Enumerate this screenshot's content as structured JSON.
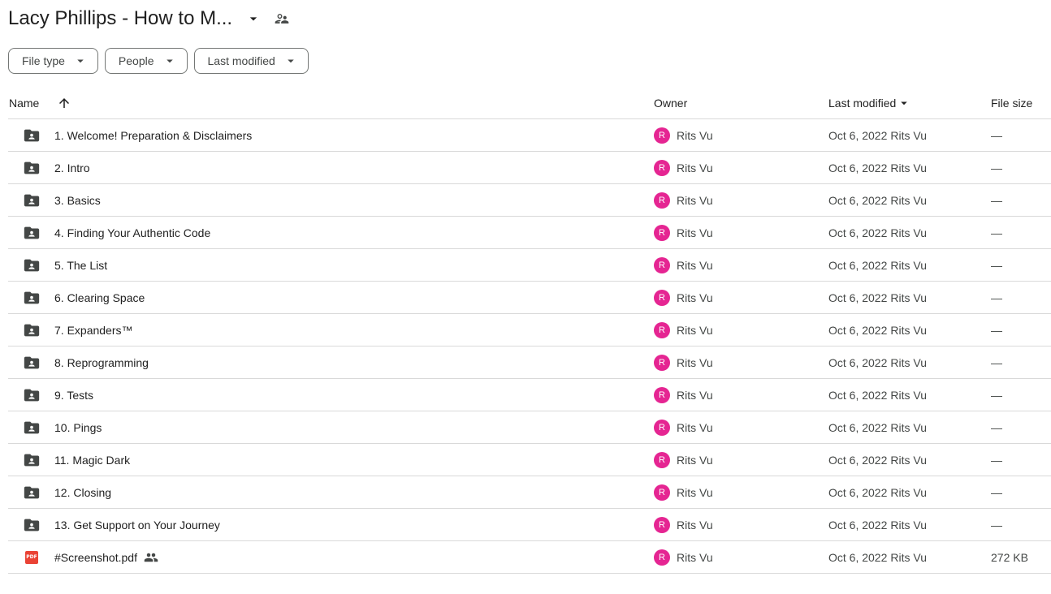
{
  "header": {
    "title": "Lacy Phillips - How to M...",
    "caret_icon": "arrow-drop-down-icon",
    "shared_icon": "shared-folder-people-icon"
  },
  "filters": [
    {
      "label": "File type"
    },
    {
      "label": "People"
    },
    {
      "label": "Last modified"
    }
  ],
  "table": {
    "columns": {
      "name": "Name",
      "owner": "Owner",
      "last_modified": "Last modified",
      "file_size": "File size"
    },
    "rows": [
      {
        "name": "1. Welcome! Preparation & Disclaimers",
        "type": "shared-folder",
        "owner": "Rits Vu",
        "owner_initial": "R",
        "date": "Oct 6, 2022",
        "modified_by": "Rits Vu",
        "size": "—"
      },
      {
        "name": "2. Intro",
        "type": "shared-folder",
        "owner": "Rits Vu",
        "owner_initial": "R",
        "date": "Oct 6, 2022",
        "modified_by": "Rits Vu",
        "size": "—"
      },
      {
        "name": "3. Basics",
        "type": "shared-folder",
        "owner": "Rits Vu",
        "owner_initial": "R",
        "date": "Oct 6, 2022",
        "modified_by": "Rits Vu",
        "size": "—"
      },
      {
        "name": "4. Finding Your Authentic Code",
        "type": "shared-folder",
        "owner": "Rits Vu",
        "owner_initial": "R",
        "date": "Oct 6, 2022",
        "modified_by": "Rits Vu",
        "size": "—"
      },
      {
        "name": "5. The List",
        "type": "shared-folder",
        "owner": "Rits Vu",
        "owner_initial": "R",
        "date": "Oct 6, 2022",
        "modified_by": "Rits Vu",
        "size": "—"
      },
      {
        "name": "6. Clearing Space",
        "type": "shared-folder",
        "owner": "Rits Vu",
        "owner_initial": "R",
        "date": "Oct 6, 2022",
        "modified_by": "Rits Vu",
        "size": "—"
      },
      {
        "name": "7. Expanders™",
        "type": "shared-folder",
        "owner": "Rits Vu",
        "owner_initial": "R",
        "date": "Oct 6, 2022",
        "modified_by": "Rits Vu",
        "size": "—"
      },
      {
        "name": "8. Reprogramming",
        "type": "shared-folder",
        "owner": "Rits Vu",
        "owner_initial": "R",
        "date": "Oct 6, 2022",
        "modified_by": "Rits Vu",
        "size": "—"
      },
      {
        "name": "9. Tests",
        "type": "shared-folder",
        "owner": "Rits Vu",
        "owner_initial": "R",
        "date": "Oct 6, 2022",
        "modified_by": "Rits Vu",
        "size": "—"
      },
      {
        "name": "10. Pings",
        "type": "shared-folder",
        "owner": "Rits Vu",
        "owner_initial": "R",
        "date": "Oct 6, 2022",
        "modified_by": "Rits Vu",
        "size": "—"
      },
      {
        "name": "11. Magic Dark",
        "type": "shared-folder",
        "owner": "Rits Vu",
        "owner_initial": "R",
        "date": "Oct 6, 2022",
        "modified_by": "Rits Vu",
        "size": "—"
      },
      {
        "name": "12. Closing",
        "type": "shared-folder",
        "owner": "Rits Vu",
        "owner_initial": "R",
        "date": "Oct 6, 2022",
        "modified_by": "Rits Vu",
        "size": "—"
      },
      {
        "name": "13. Get Support on Your Journey",
        "type": "shared-folder",
        "owner": "Rits Vu",
        "owner_initial": "R",
        "date": "Oct 6, 2022",
        "modified_by": "Rits Vu",
        "size": "—"
      },
      {
        "name": "#Screenshot.pdf",
        "type": "pdf",
        "pdf_badge": "PDF",
        "shared": true,
        "owner": "Rits Vu",
        "owner_initial": "R",
        "date": "Oct 6, 2022",
        "modified_by": "Rits Vu",
        "size": "272 KB"
      }
    ]
  },
  "colors": {
    "avatar": "#e52592",
    "pdf": "#ea4335",
    "folder_icon": "#444746",
    "divider": "#d9d9d9"
  }
}
